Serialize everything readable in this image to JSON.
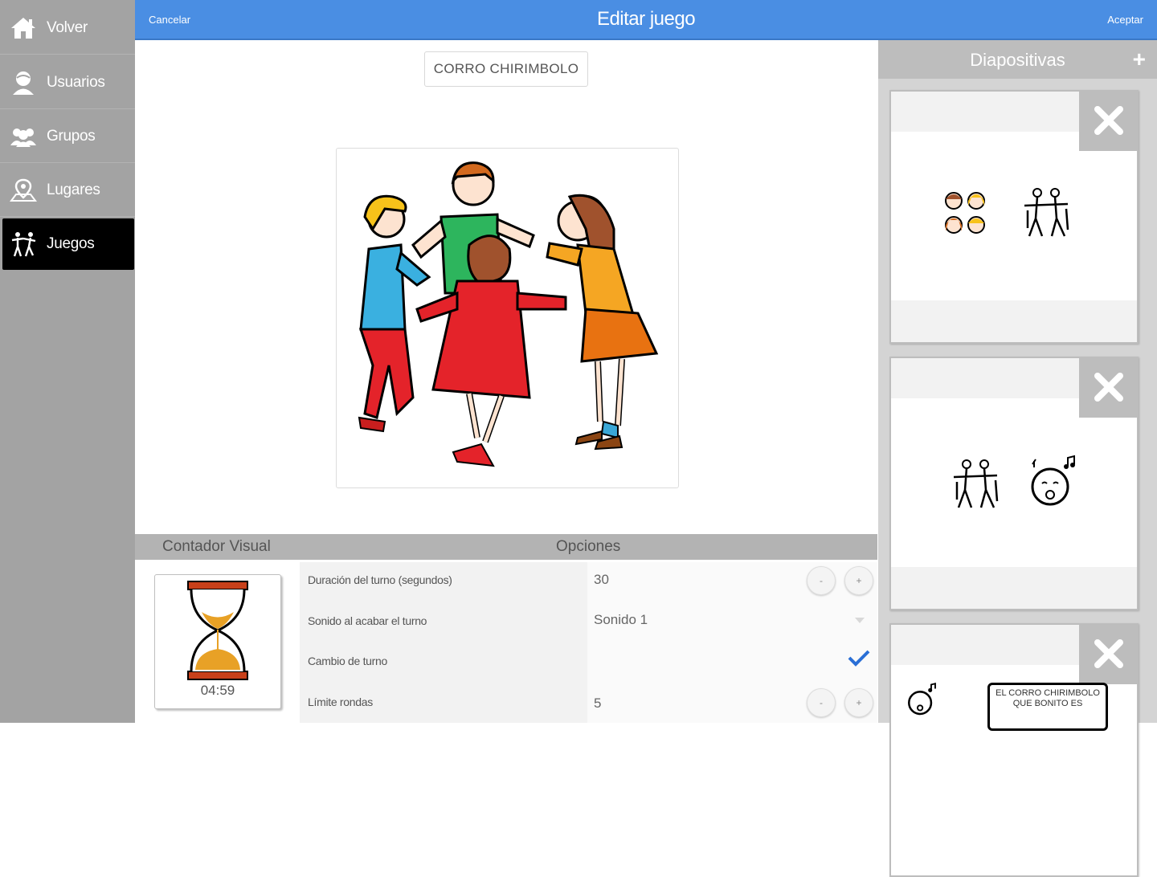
{
  "sidebar": {
    "items": [
      {
        "label": "Volver",
        "icon": "home-icon"
      },
      {
        "label": "Usuarios",
        "icon": "user-icon"
      },
      {
        "label": "Grupos",
        "icon": "group-icon"
      },
      {
        "label": "Lugares",
        "icon": "place-icon"
      },
      {
        "label": "Juegos",
        "icon": "game-icon",
        "active": true
      }
    ]
  },
  "topbar": {
    "cancel": "Cancelar",
    "title": "Editar juego",
    "accept": "Aceptar"
  },
  "game": {
    "name": "CORRO CHIRIMBOLO"
  },
  "bottom": {
    "counter_header": "Contador Visual",
    "options_header": "Opciones",
    "counter_time": "04:59",
    "options": [
      {
        "label": "Duración del turno (segundos)",
        "value": "30"
      },
      {
        "label": "Sonido al acabar el turno",
        "value": "Sonido 1"
      },
      {
        "label": "Cambio de turno",
        "value": ""
      },
      {
        "label": "Límite rondas",
        "value": "5"
      }
    ],
    "minus": "-",
    "plus": "+"
  },
  "panel": {
    "title": "Diapositivas",
    "add": "+",
    "slide3_caption": "EL CORRO CHIRIMBOLO QUE BONITO ES"
  },
  "colors": {
    "topbar": "#4a8ee3",
    "sidebar": "#a3a3a3",
    "active": "#000000",
    "check": "#2a6fd6"
  }
}
